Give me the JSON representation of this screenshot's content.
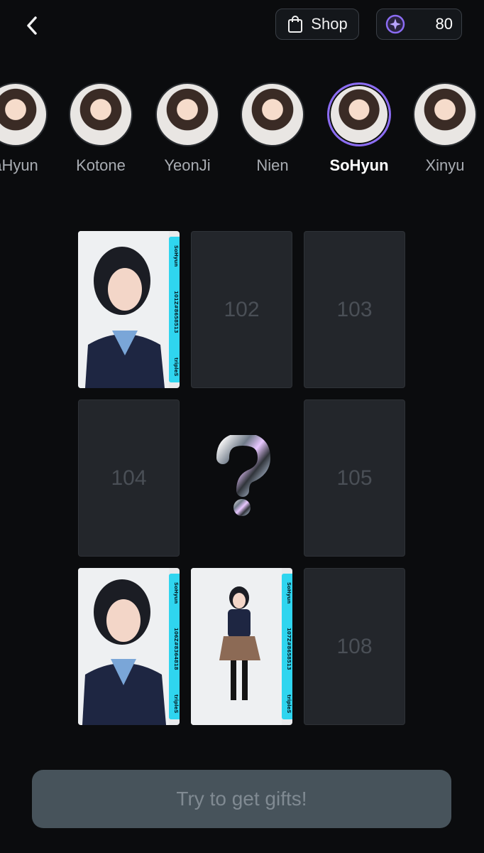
{
  "header": {
    "shop_label": "Shop",
    "coin_count": "80"
  },
  "members": [
    {
      "name": "aHyun",
      "selected": false
    },
    {
      "name": "Kotone",
      "selected": false
    },
    {
      "name": "YeonJi",
      "selected": false
    },
    {
      "name": "Nien",
      "selected": false
    },
    {
      "name": "SoHyun",
      "selected": true
    },
    {
      "name": "Xinyu",
      "selected": false
    }
  ],
  "slots": {
    "101": {
      "member": "SoHyun",
      "code": "101Z#8658513",
      "brand": "tripleS"
    },
    "102": {
      "number": "102"
    },
    "103": {
      "number": "103"
    },
    "104": {
      "number": "104"
    },
    "105": {
      "number": "105"
    },
    "106": {
      "member": "SoHyun",
      "code": "106Z#8364818",
      "brand": "tripleS"
    },
    "107": {
      "member": "SoHyun",
      "code": "107Z#8658513",
      "brand": "tripleS"
    },
    "108": {
      "number": "108"
    }
  },
  "cta": {
    "label": "Try to get gifts!"
  },
  "colors": {
    "accent": "#8b6cf3",
    "card_strip": "#2fd5ef",
    "background": "#0b0c0e"
  }
}
